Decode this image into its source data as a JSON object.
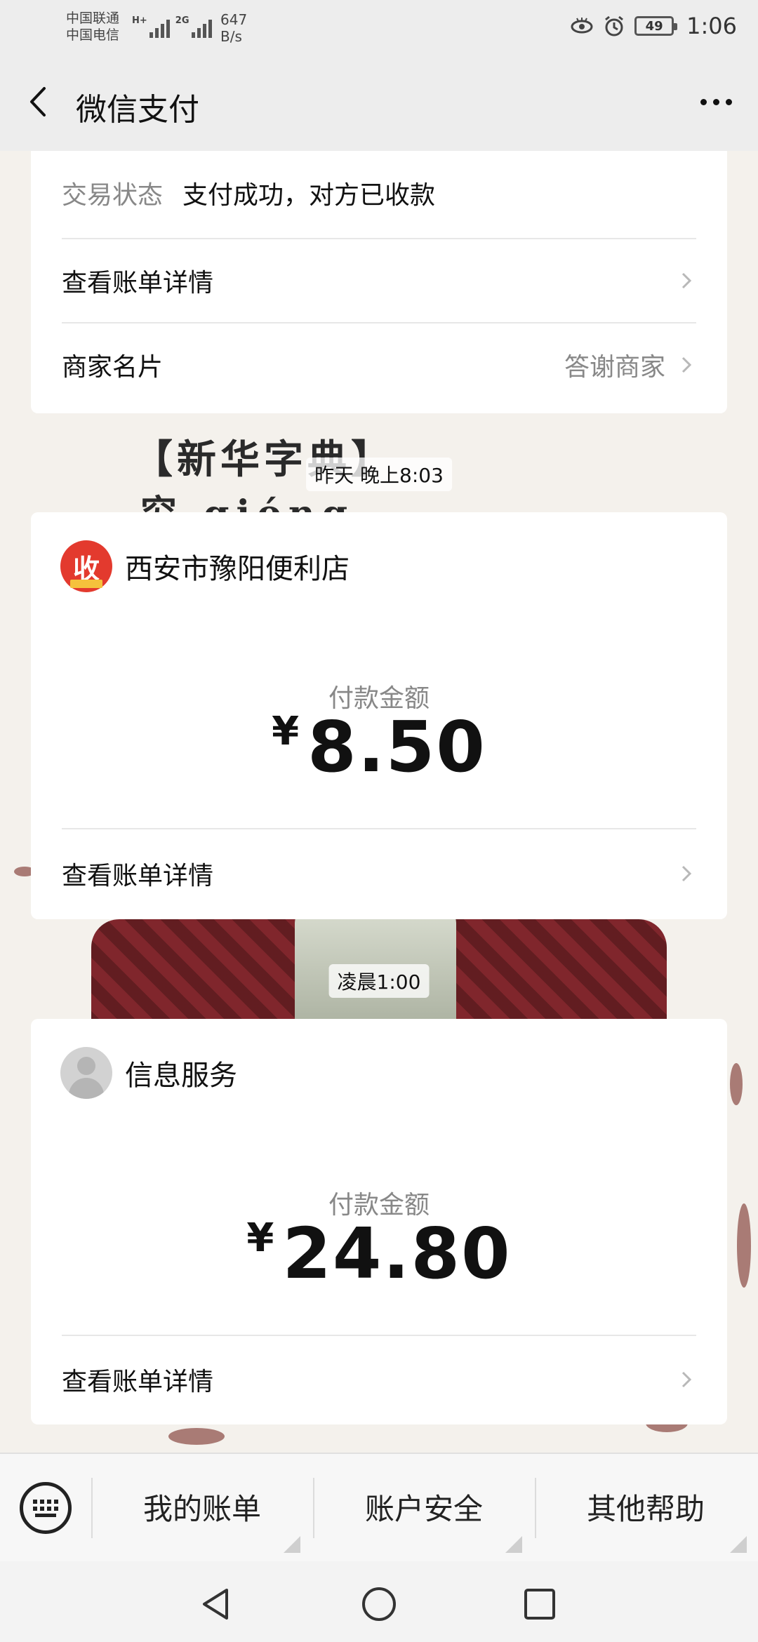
{
  "status_bar": {
    "carrier1": "中国联通",
    "carrier2": "中国电信",
    "net1": "H+",
    "net2": "2G",
    "speed_value": "647",
    "speed_unit": "B/s",
    "battery": "49",
    "time": "1:06"
  },
  "header": {
    "title": "微信支付"
  },
  "card_top": {
    "status_label": "交易状态",
    "status_value": "支付成功，对方已收款",
    "view_bill_label": "查看账单详情",
    "merchant_card_label": "商家名片",
    "thank_merchant_label": "答谢商家"
  },
  "wallpaper": {
    "line1": "【新华字典】",
    "line2": "穷 qióng"
  },
  "messages": [
    {
      "time": "昨天 晚上8:03",
      "merchant": "西安市豫阳便利店",
      "amount_label": "付款金额",
      "currency": "¥",
      "amount": "8.50",
      "view_bill_label": "查看账单详情"
    },
    {
      "time": "凌晨1:00",
      "merchant": "信息服务",
      "amount_label": "付款金额",
      "currency": "¥",
      "amount": "24.80",
      "view_bill_label": "查看账单详情"
    }
  ],
  "logo_text": "收",
  "bottom_menu": {
    "items": [
      "我的账单",
      "账户安全",
      "其他帮助"
    ]
  }
}
